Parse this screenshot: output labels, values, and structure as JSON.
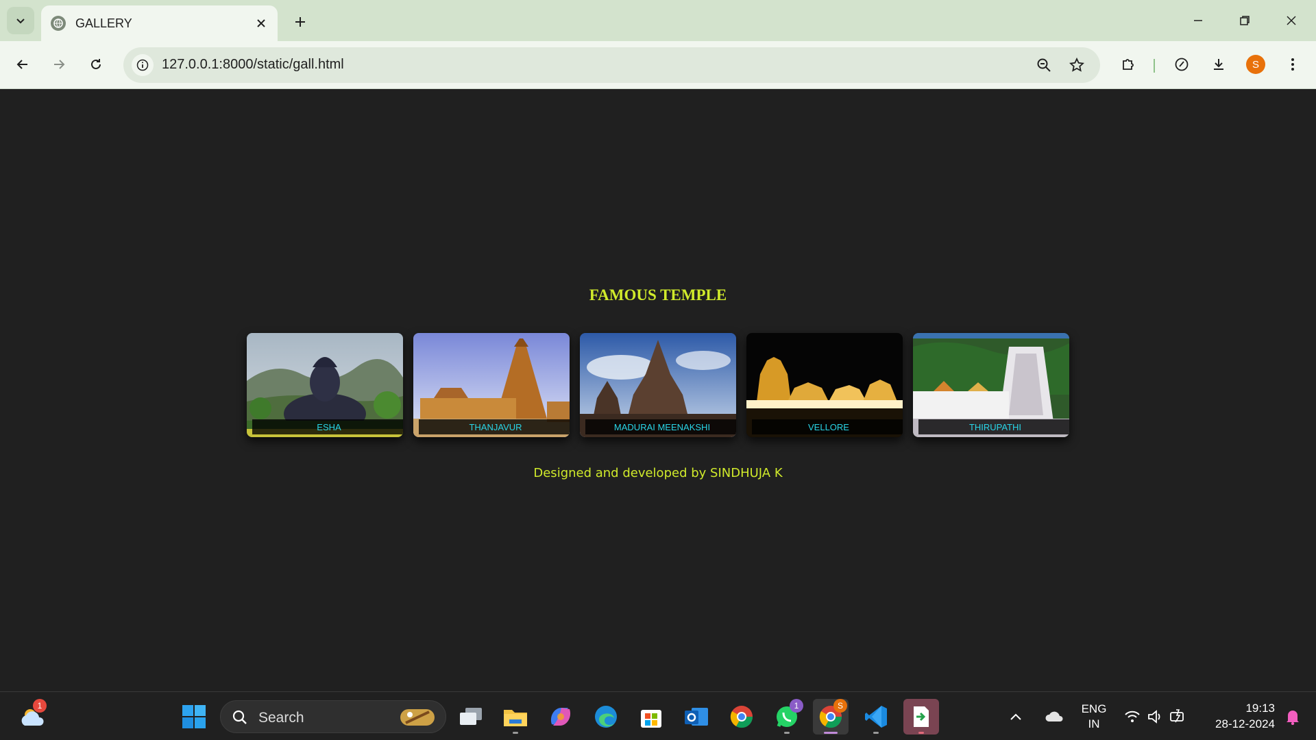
{
  "browser": {
    "tab_title": "GALLERY",
    "url": "127.0.0.1:8000/static/gall.html",
    "profile_initial": "S"
  },
  "page": {
    "heading": "FAMOUS TEMPLE",
    "gallery": [
      {
        "caption": "ESHA",
        "theme": "statue"
      },
      {
        "caption": "THANJAVUR",
        "theme": "temple-day"
      },
      {
        "caption": "MADURAI MEENAKSHI",
        "theme": "shore-temple"
      },
      {
        "caption": "VELLORE",
        "theme": "golden-night"
      },
      {
        "caption": "THIRUPATHI",
        "theme": "white-gopuram"
      }
    ],
    "footer": "Designed and developed by SINDHUJA K"
  },
  "taskbar": {
    "search_label": "Search",
    "weather_badge": "1",
    "whatsapp_badge": "1",
    "chrome_badge": "S",
    "language_line1": "ENG",
    "language_line2": "IN",
    "time": "19:13",
    "date": "28-12-2024"
  },
  "colors": {
    "accent_text": "#d0ea2b",
    "caption_text": "#29d6e8",
    "page_bg": "#202020",
    "chrome_frame": "#d3e3cd"
  }
}
